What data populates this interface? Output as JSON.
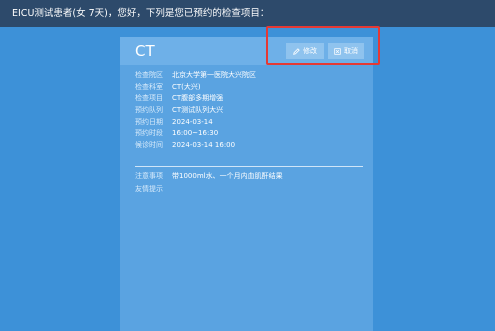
{
  "header": {
    "greeting": "EICU测试患者(女  7天)，您好，下列是您已预约的检查项目："
  },
  "card": {
    "title": "CT",
    "edit_label": "修改",
    "cancel_label": "取消",
    "info": [
      {
        "label": "检查院区",
        "value": "北京大学第一医院大兴院区"
      },
      {
        "label": "检查科室",
        "value": "CT(大兴)"
      },
      {
        "label": "检查项目",
        "value": "CT腹部多期增强"
      },
      {
        "label": "预约队列",
        "value": "CT测试队列大兴"
      },
      {
        "label": "预约日期",
        "value": "2024-03-14"
      },
      {
        "label": "预约时段",
        "value": "16:00~16:30"
      },
      {
        "label": "候诊时间",
        "value": "2024-03-14   16:00"
      }
    ],
    "notes": [
      {
        "label": "注意事项",
        "value": "带1000ml水、一个月内血肌酐结果"
      },
      {
        "label": "友情提示",
        "value": ""
      }
    ]
  },
  "colors": {
    "background": "#3d91d8",
    "topbar": "#2d4a6b",
    "card": "#5aa3e1",
    "highlight": "#e53935"
  }
}
